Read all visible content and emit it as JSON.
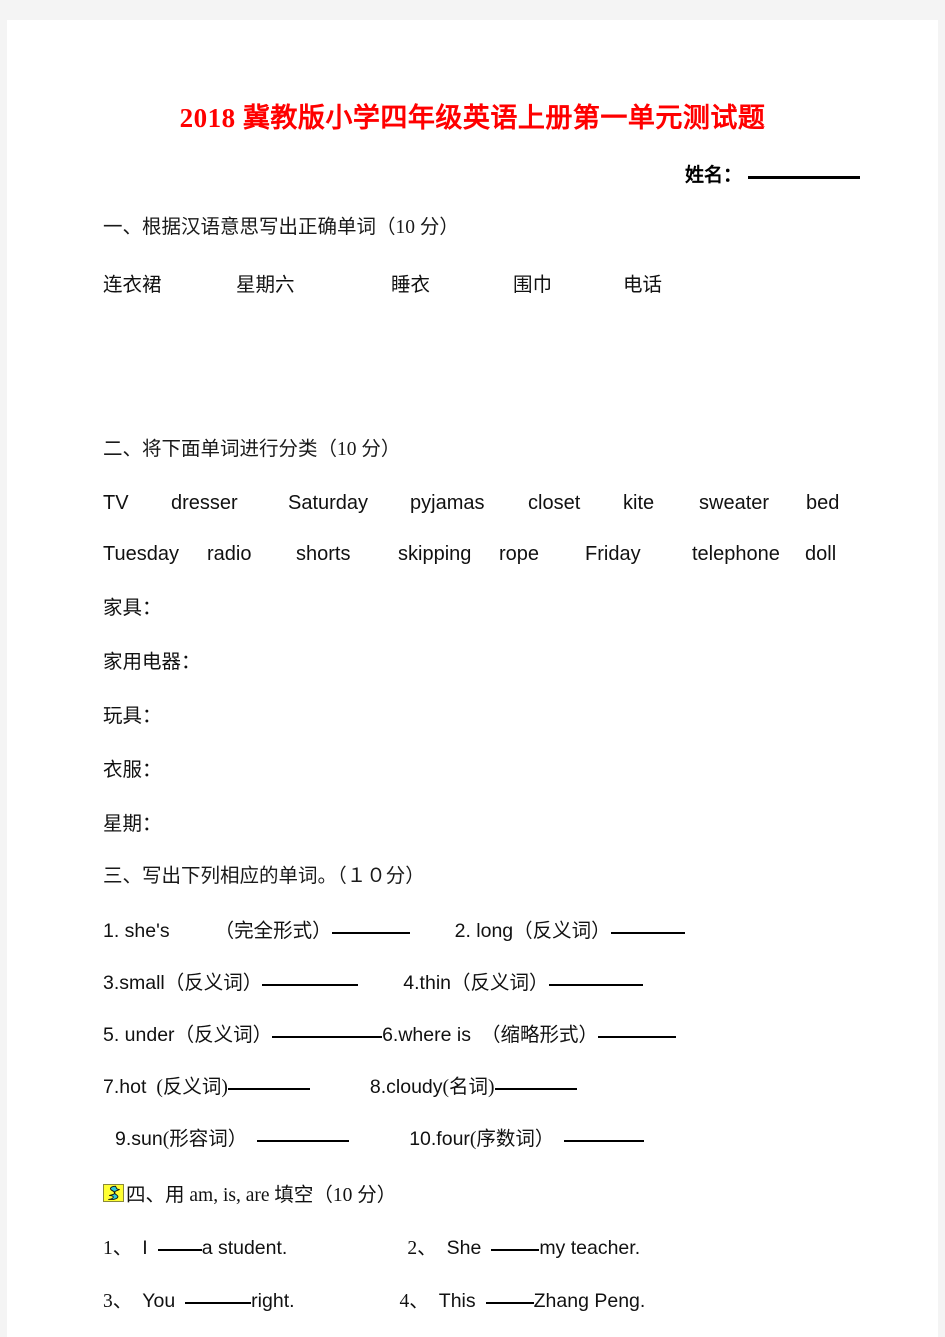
{
  "document": {
    "title": "2018 冀教版小学四年级英语上册第一单元测试题",
    "title_year": "2018",
    "title_rest": " 冀教版小学四年级英语上册第一单元测试题",
    "title_color": "#ff0000",
    "name_label": "姓名："
  },
  "section1": {
    "heading": "一、根据汉语意思写出正确单词（10 分）",
    "words": [
      "连衣裙",
      "星期六",
      "睡衣",
      "围巾",
      "电话"
    ]
  },
  "section2": {
    "heading": "二、将下面单词进行分类（10 分）",
    "wordbank_row1": [
      "TV",
      "dresser",
      "Saturday",
      "pyjamas",
      "closet",
      "kite",
      "sweater",
      "bed"
    ],
    "wordbank_row2": [
      "Tuesday",
      "radio",
      "shorts",
      "skipping",
      "rope",
      "Friday",
      "telephone",
      "doll"
    ],
    "categories": [
      "家具：",
      "家用电器：",
      "玩具：",
      "衣服：",
      "星期："
    ]
  },
  "section3": {
    "heading": "三、写出下列相应的单词。（１０分）",
    "items": [
      {
        "num": "1.",
        "word": "she's",
        "hint": "（完全形式）"
      },
      {
        "num": "2.",
        "word": "long",
        "hint": "（反义词）"
      },
      {
        "num": "3.",
        "word": "small",
        "hint": "（反义词）"
      },
      {
        "num": "4.",
        "word": "thin",
        "hint": "（反义词）"
      },
      {
        "num": "5.",
        "word": "under",
        "hint": "（反义词）"
      },
      {
        "num": "6.",
        "word": "where is",
        "hint": "（缩略形式）"
      },
      {
        "num": "7.",
        "word": "hot",
        "hint": "(反义词)"
      },
      {
        "num": "8.",
        "word": "cloudy",
        "hint": "(名词)"
      },
      {
        "num": "9.",
        "word": "sun",
        "hint": "(形容词）"
      },
      {
        "num": "10.",
        "word": "four",
        "hint": "(序数词）"
      }
    ],
    "line1_left": "1. she's",
    "line1_left_hint": "（完全形式）",
    "line1_right": "2. long",
    "line1_right_hint": "（反义词）",
    "line2_left": "3.small",
    "line2_left_hint": "（反义词）",
    "line2_right": "4.thin",
    "line2_right_hint": "（反义词）",
    "line3_left": "5. under",
    "line3_left_hint": "（反义词）",
    "line3_right": "6.where is",
    "line3_right_hint": "（缩略形式）",
    "line4_left": "7.hot",
    "line4_left_hint": "(反义词)",
    "line4_right": "8.cloudy",
    "line4_right_hint": "(名词)",
    "line5_left": "9.sun",
    "line5_left_hint": "(形容词）",
    "line5_right": "10.four",
    "line5_right_hint": "(序数词）"
  },
  "section4": {
    "icon": "yellow-swirl-bullet-icon",
    "heading": "四、用 am, is, are  填空（10 分）",
    "items": [
      {
        "num": "1、",
        "before": "I ",
        "after": "a student."
      },
      {
        "num": "2、",
        "before": "She ",
        "after": "my teacher."
      },
      {
        "num": "3、",
        "before": "You ",
        "after": "right."
      },
      {
        "num": "4、",
        "before": "This ",
        "after": "Zhang Peng."
      }
    ],
    "q1_num": "1、",
    "q1_before": "I",
    "q1_after": "a student.",
    "q2_num": "2、",
    "q2_before": "She",
    "q2_after": "my teacher.",
    "q3_num": "3、",
    "q3_before": "You",
    "q3_after": "right.",
    "q4_num": "4、",
    "q4_before": "This",
    "q4_after": "Zhang Peng."
  }
}
